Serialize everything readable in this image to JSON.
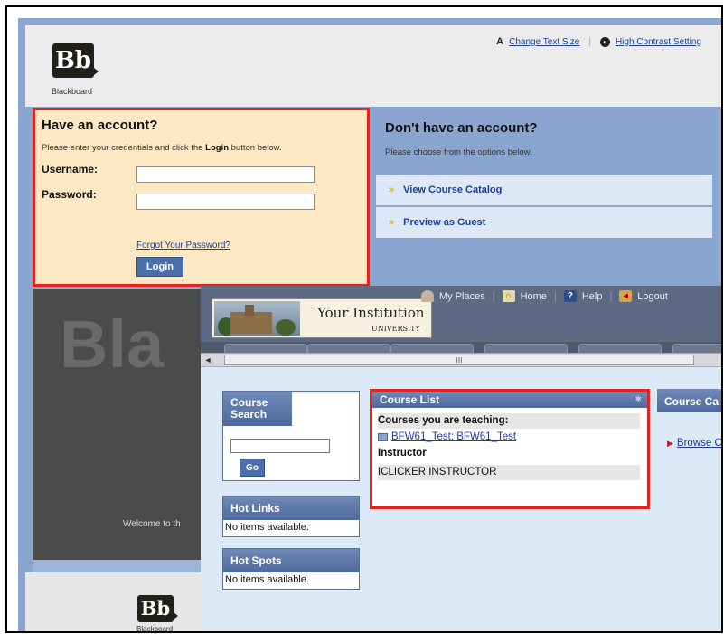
{
  "login": {
    "logo_text": "Bb",
    "logo_caption": "Blackboard",
    "change_text_size": "Change Text Size",
    "high_contrast": "High Contrast Setting",
    "have_account_title": "Have an account?",
    "instructions_pre": "Please enter your credentials and click the ",
    "instructions_bold": "Login",
    "instructions_post": " button below.",
    "username_label": "Username:",
    "password_label": "Password:",
    "username_value": "",
    "password_value": "",
    "forgot_password": "Forgot Your Password?",
    "login_button": "Login",
    "dont_have_title": "Don't have an account?",
    "dont_have_instr": "Please choose from the options below.",
    "options": [
      "View Course Catalog",
      "Preview as Guest"
    ],
    "background_text": "Bla",
    "welcome_text": "Welcome to th"
  },
  "course": {
    "nav": [
      "My Places",
      "Home",
      "Help",
      "Logout"
    ],
    "institution_name": "Your Institution",
    "institution_sub": "UNIVERSITY",
    "scroll_grip": "III",
    "course_search_title": "Course Search",
    "go_button": "Go",
    "hot_links_title": "Hot Links",
    "hot_links_empty": "No items available.",
    "hot_spots_title": "Hot Spots",
    "hot_spots_empty": "No items available.",
    "course_list_title": "Course List",
    "teaching_heading": "Courses you are teaching:",
    "course_link": "BFW61_Test: BFW61_Test",
    "instructor_label": "Instructor",
    "instructor_name": "ICLICKER INSTRUCTOR",
    "course_catalog_title": "Course Ca",
    "browse_link": "Browse C"
  },
  "bottom_logo": {
    "text": "Bb",
    "caption": "Blackboard"
  },
  "colors": {
    "highlight_border": "#e22320",
    "login_box": "#fce8c3",
    "accent_blue": "#4a6fab",
    "page_blue": "#8aa6d0"
  }
}
